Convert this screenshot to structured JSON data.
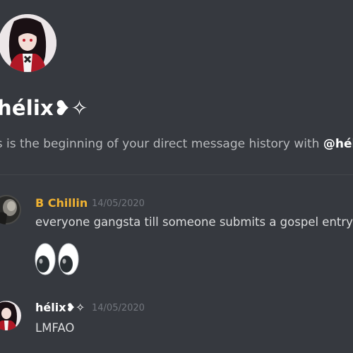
{
  "dm_header": {
    "title": "hélix❥✧",
    "subtitle_prefix": "is is the beginning of your direct message history with ",
    "subtitle_mention": "@hél"
  },
  "messages": [
    {
      "author": "B Chillin",
      "author_color": "#f0b232",
      "timestamp": "14/05/2020",
      "text": "everyone gangsta till someone submits a gospel entry",
      "emoji": "eyes-emoji"
    },
    {
      "author": "hélix❥✧",
      "author_color": "#ffffff",
      "timestamp": "14/05/2020",
      "text": "LMFAO"
    }
  ],
  "colors": {
    "background": "#36393f",
    "divider": "#42454a",
    "muted_text": "#72767d"
  }
}
